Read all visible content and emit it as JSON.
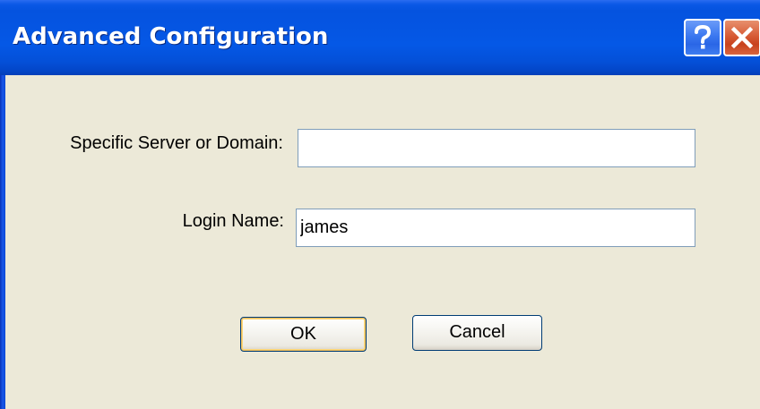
{
  "window": {
    "title": "Advanced Configuration"
  },
  "titlebar_buttons": {
    "help_icon": "question-mark",
    "close_icon": "x-mark"
  },
  "form": {
    "server_label": "Specific Server or Domain:",
    "server_value": "",
    "login_label": "Login Name:",
    "login_value": "james"
  },
  "buttons": {
    "ok_label": "OK",
    "cancel_label": "Cancel"
  },
  "colors": {
    "titlebar": "#0553df",
    "dialog_background": "#ece9d8",
    "close_button": "#d75b36",
    "help_button": "#3b78f0"
  }
}
